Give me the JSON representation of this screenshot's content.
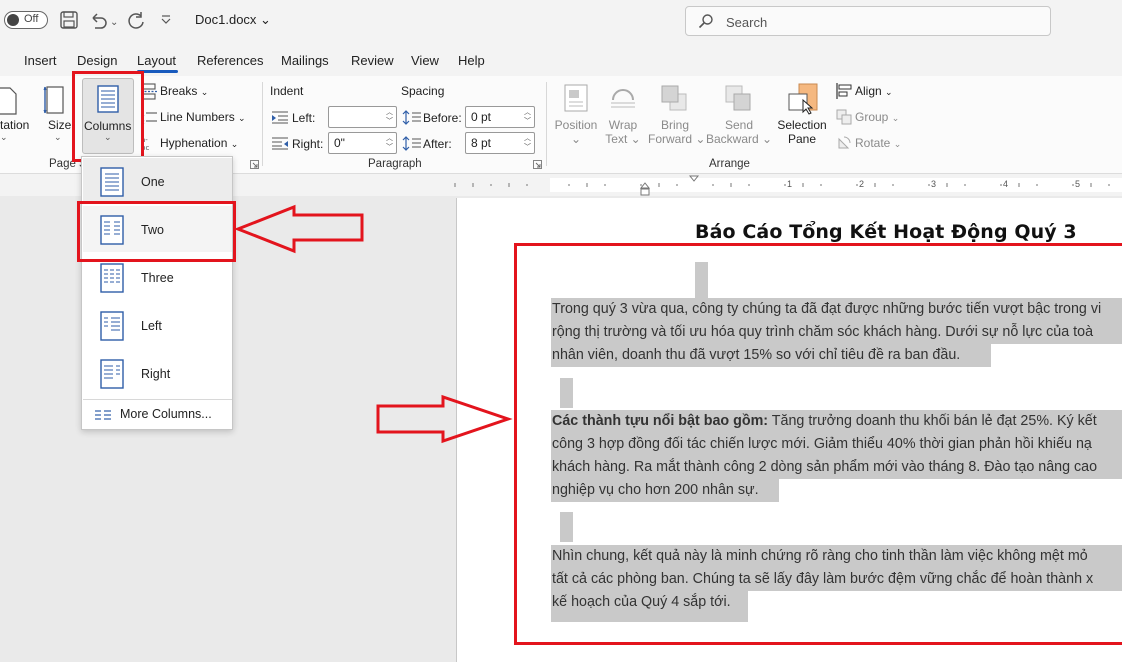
{
  "titlebar": {
    "autosave_label": "Off",
    "doc_title": "Doc1.docx",
    "search_placeholder": "Search"
  },
  "tabs": [
    "Insert",
    "Design",
    "Layout",
    "References",
    "Mailings",
    "Review",
    "View",
    "Help"
  ],
  "active_tab": "Layout",
  "ribbon": {
    "page_setup": {
      "orientation_label": "tation",
      "size_label": "Size",
      "columns_label": "Columns",
      "breaks_label": "Breaks",
      "line_numbers_label": "Line Numbers",
      "hyphenation_label": "Hyphenation",
      "group_label": "Page S"
    },
    "paragraph": {
      "indent_label": "Indent",
      "spacing_label": "Spacing",
      "left_label": "Left:",
      "right_label": "Right:",
      "left_value": "",
      "right_value": "0\"",
      "before_label": "Before:",
      "after_label": "After:",
      "before_value": "0 pt",
      "after_value": "8 pt",
      "group_label": "Paragraph"
    },
    "arrange": {
      "position_label": [
        "Position",
        "⌄"
      ],
      "wrap_label": [
        "Wrap",
        "Text ⌄"
      ],
      "bring_label": [
        "Bring",
        "Forward ⌄"
      ],
      "send_label": [
        "Send",
        "Backward ⌄"
      ],
      "selection_label": [
        "Selection",
        "Pane"
      ],
      "align_label": "Align",
      "group_label_btn": "Group",
      "rotate_label": "Rotate",
      "group_label": "Arrange"
    }
  },
  "columns_menu": {
    "items": [
      {
        "label": "One"
      },
      {
        "label": "Two"
      },
      {
        "label": "Three"
      },
      {
        "label": "Left"
      },
      {
        "label": "Right"
      }
    ],
    "more": "More Columns..."
  },
  "ruler_numbers": [
    "1",
    "2",
    "3",
    "4",
    "5"
  ],
  "document": {
    "heading": "Báo Cáo Tổng Kết Hoạt Động Quý 3",
    "para1": [
      "Trong quý 3 vừa qua, công ty chúng ta đã đạt được những bước tiến vượt bậc trong vi",
      "rộng thị trường và tối ưu hóa quy trình chăm sóc khách hàng. Dưới sự nỗ lực của toà",
      "nhân viên, doanh thu đã vượt 15% so với chỉ tiêu đề ra ban đầu."
    ],
    "para2_bold": "Các thành tựu nổi bật bao gồm:",
    "para2": [
      " Tăng trưởng doanh thu khối bán lẻ đạt 25%. Ký kết",
      "công 3 hợp đồng đối tác chiến lược mới. Giảm thiểu 40% thời gian phản hồi khiếu nạ",
      "khách hàng. Ra mắt thành công 2 dòng sản phẩm mới vào tháng 8. Đào tạo nâng cao",
      "nghiệp vụ cho hơn 200 nhân sự."
    ],
    "para3": [
      "Nhìn chung, kết quả này là minh chứng rõ ràng cho tinh thần làm việc không mệt mỏ",
      "tất cả các phòng ban. Chúng ta sẽ lấy đây làm bước đệm vững chắc để hoàn thành x",
      "kế hoạch của Quý 4 sắp tới."
    ]
  },
  "colors": {
    "annotation_red": "#e3141d",
    "accent_blue": "#185abd",
    "selection_gray": "#c9c9c9"
  }
}
